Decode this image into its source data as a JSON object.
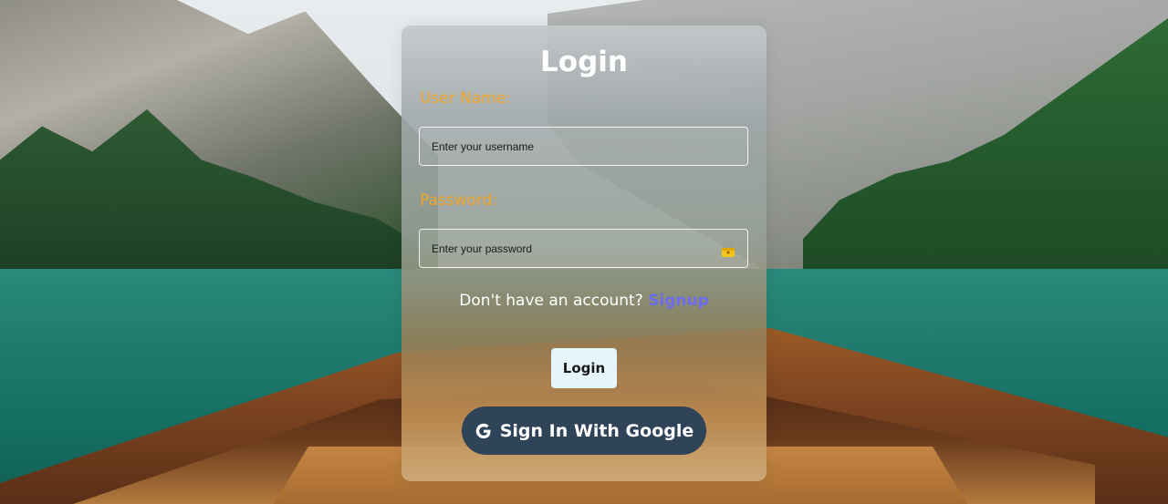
{
  "login_form": {
    "title": "Login",
    "username_label": "User Name:",
    "username_placeholder": "Enter your username",
    "password_label": "Password:",
    "password_placeholder": "Enter your password",
    "password_icon": "lock-icon",
    "signup_prompt": "Don't have an account?",
    "signup_link": "Signup",
    "login_button": "Login",
    "google_button": "Sign In With Google",
    "google_icon": "google-g-icon"
  },
  "colors": {
    "label": "#f0a52b",
    "signup_link": "#6d6cf0",
    "login_button_bg": "#e6f5fb",
    "google_button_bg": "#2f4359"
  }
}
